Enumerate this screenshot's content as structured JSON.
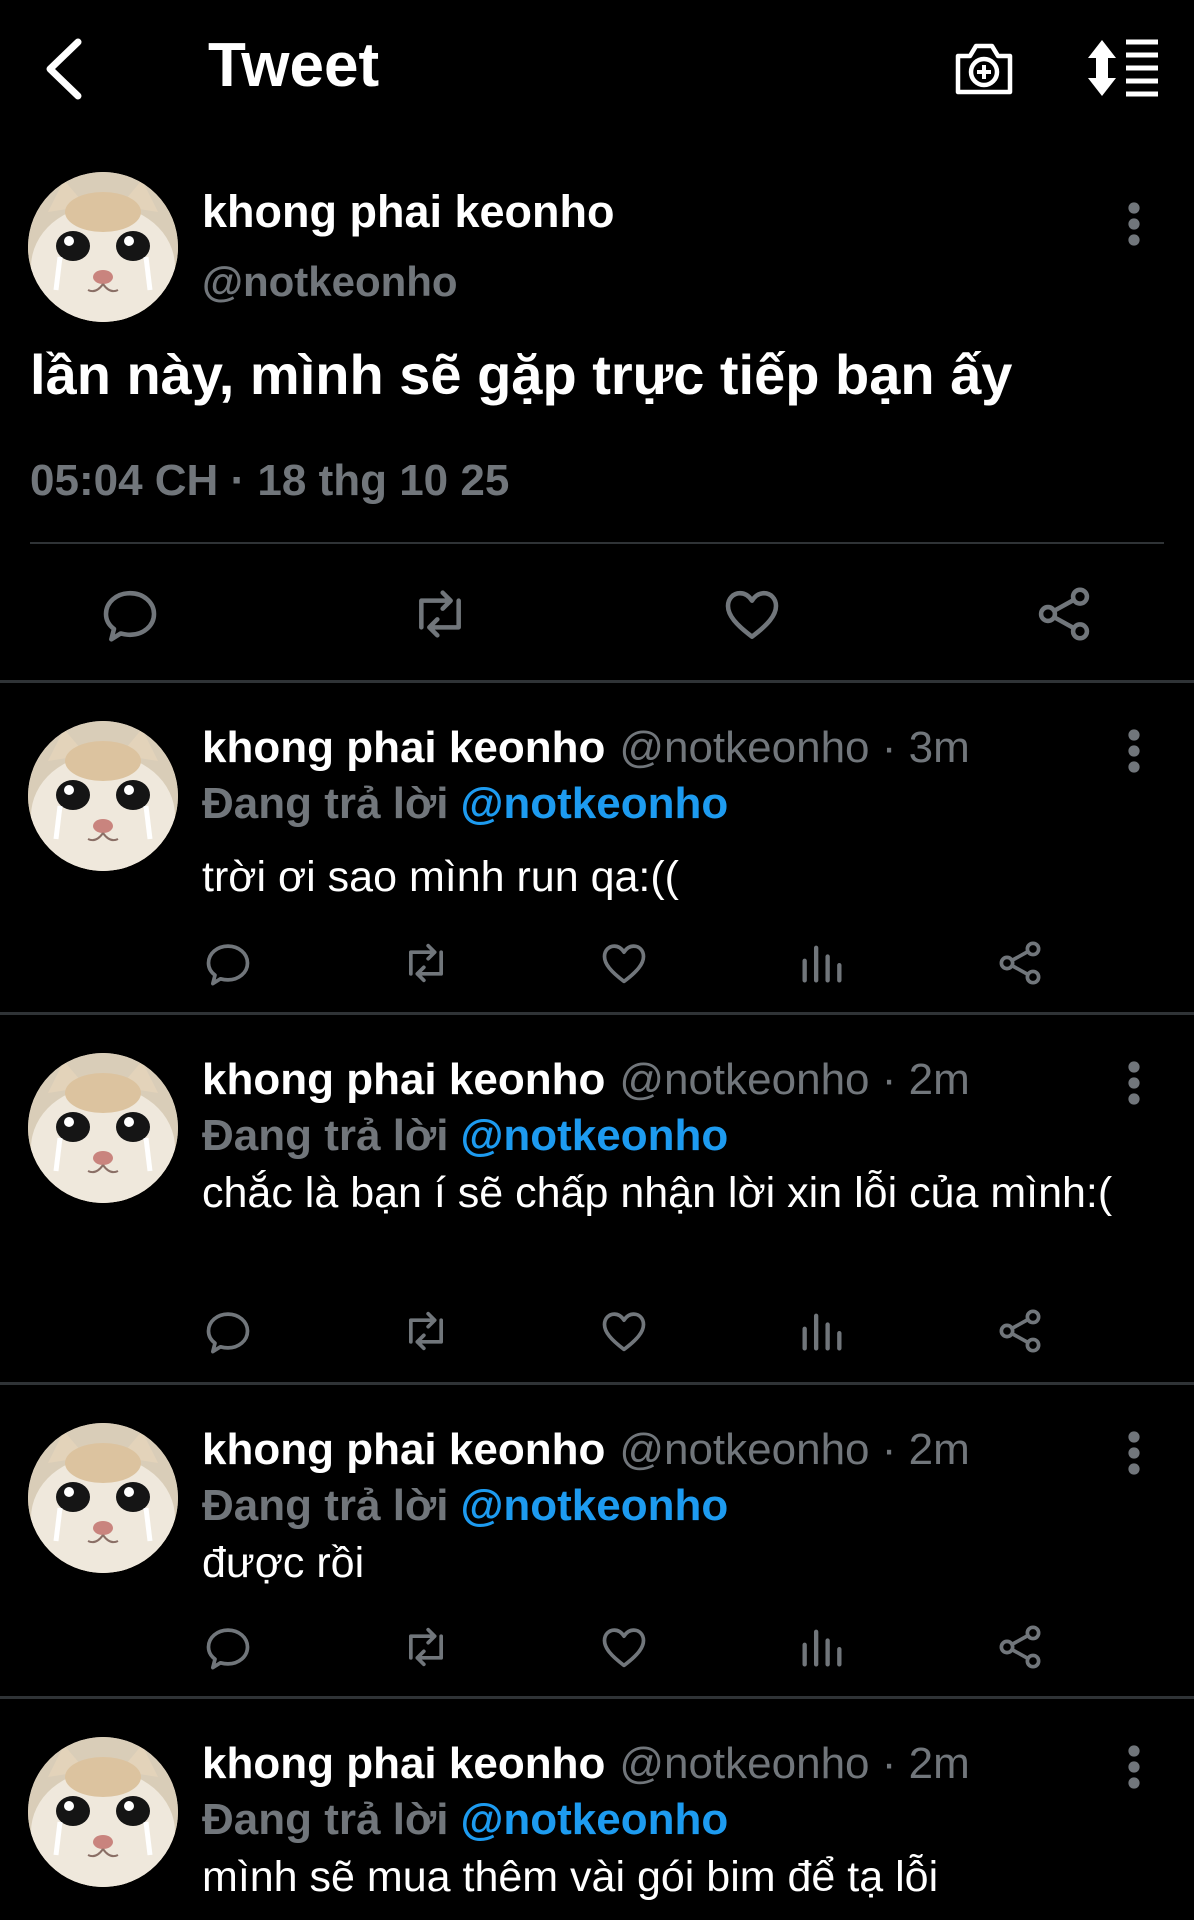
{
  "header": {
    "title": "Tweet"
  },
  "main_tweet": {
    "name": "khong phai keonho",
    "handle": "@notkeonho",
    "text": "lần này, mình sẽ gặp trực tiếp bạn ấy",
    "timestamp": "05:04 CH · 18 thg 10 25"
  },
  "replies": [
    {
      "name": "khong phai keonho",
      "meta": "@notkeonho · 3m",
      "replying_label": "Đang trả lời",
      "mention": "@notkeonho",
      "text": "trời ơi sao mình run qa:(("
    },
    {
      "name": "khong phai keonho",
      "meta": "@notkeonho · 2m",
      "replying_label": "Đang trả lời",
      "mention": "@notkeonho",
      "text": "chắc là bạn í sẽ chấp nhận lời xin lỗi của mình:("
    },
    {
      "name": "khong phai keonho",
      "meta": "@notkeonho · 2m",
      "replying_label": "Đang trả lời",
      "mention": "@notkeonho",
      "text": "được rồi"
    },
    {
      "name": "khong phai keonho",
      "meta": "@notkeonho · 2m",
      "replying_label": "Đang trả lời",
      "mention": "@notkeonho",
      "text": "mình sẽ mua thêm vài gói bim để tạ lỗi"
    }
  ],
  "colors": {
    "background": "#000000",
    "text": "#e7e9ea",
    "muted": "#71767b",
    "accent": "#1d9bf0",
    "divider": "#2f3336"
  },
  "icons": [
    "back-arrow-icon",
    "camera-add-icon",
    "sort-icon",
    "more-vertical-icon",
    "reply-icon",
    "retweet-icon",
    "like-icon",
    "share-icon",
    "views-icon"
  ]
}
